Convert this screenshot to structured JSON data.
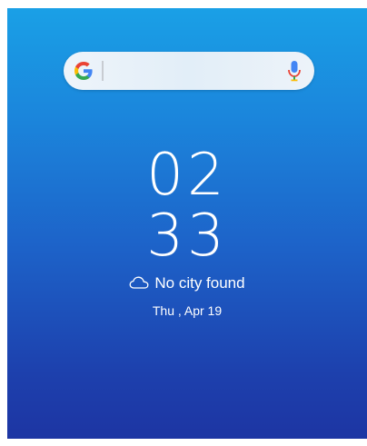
{
  "search": {
    "logo_icon": "google-g-icon",
    "mic_icon": "microphone-icon",
    "colors": {
      "blue": "#4285F4",
      "red": "#EA4335",
      "yellow": "#FBBC05",
      "green": "#34A853"
    }
  },
  "clock": {
    "hours": "02",
    "minutes": "33"
  },
  "weather": {
    "icon": "cloud-icon",
    "text": "No city found"
  },
  "date": {
    "text": "Thu , Apr 19"
  },
  "theme": {
    "background_top": "#1aa0e6",
    "background_bottom": "#1d35a3"
  }
}
